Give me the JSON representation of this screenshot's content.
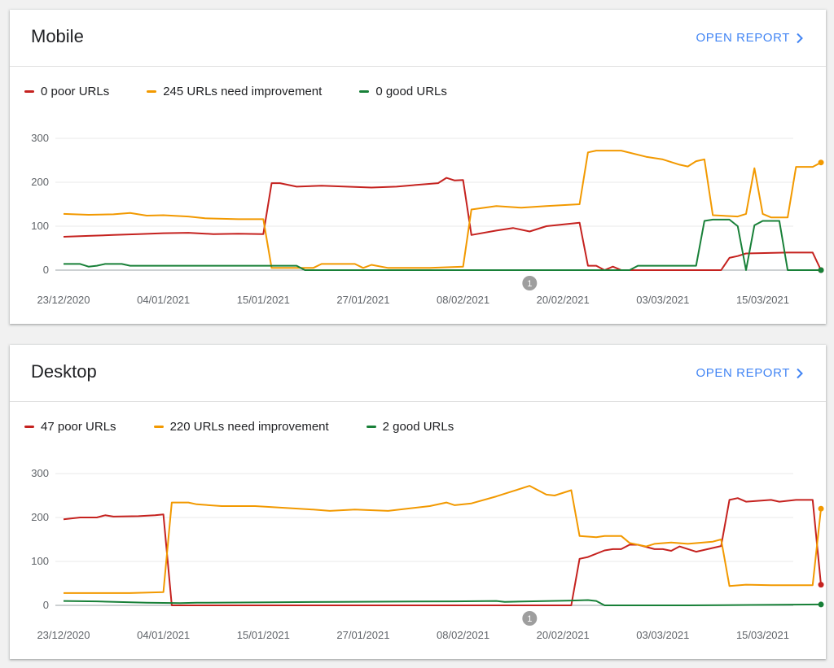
{
  "colors": {
    "poor": "#c5221f",
    "needs": "#f29900",
    "good": "#188038",
    "link": "#4285f4",
    "grid": "#e8e8e8",
    "axis": "#9aa0a6",
    "annotation": "#9e9e9e"
  },
  "open_report_label": "OPEN REPORT",
  "chart_data": [
    {
      "type": "line",
      "title": "Mobile",
      "legend": [
        "0 poor URLs",
        "245 URLs need improvement",
        "0 good URLs"
      ],
      "x_tick_labels": [
        "23/12/2020",
        "04/01/2021",
        "15/01/2021",
        "27/01/2021",
        "08/02/2021",
        "20/02/2021",
        "03/03/2021",
        "15/03/2021"
      ],
      "x_start": "2020-12-23",
      "y_ticks": [
        0,
        100,
        200,
        300
      ],
      "ylim": [
        0,
        300
      ],
      "annotations": [
        {
          "date": "2021-02-17",
          "label": "1"
        }
      ],
      "series": [
        {
          "key": "poor",
          "points": [
            [
              "2020-12-23",
              76
            ],
            [
              "2020-12-26",
              78
            ],
            [
              "2020-12-29",
              80
            ],
            [
              "2021-01-01",
              82
            ],
            [
              "2021-01-04",
              84
            ],
            [
              "2021-01-07",
              85
            ],
            [
              "2021-01-10",
              82
            ],
            [
              "2021-01-13",
              83
            ],
            [
              "2021-01-16",
              82
            ],
            [
              "2021-01-17",
              198
            ],
            [
              "2021-01-18",
              198
            ],
            [
              "2021-01-20",
              190
            ],
            [
              "2021-01-23",
              192
            ],
            [
              "2021-01-26",
              190
            ],
            [
              "2021-01-29",
              188
            ],
            [
              "2021-02-01",
              190
            ],
            [
              "2021-02-04",
              195
            ],
            [
              "2021-02-06",
              198
            ],
            [
              "2021-02-07",
              210
            ],
            [
              "2021-02-08",
              204
            ],
            [
              "2021-02-09",
              205
            ],
            [
              "2021-02-10",
              80
            ],
            [
              "2021-02-13",
              90
            ],
            [
              "2021-02-15",
              96
            ],
            [
              "2021-02-17",
              88
            ],
            [
              "2021-02-19",
              100
            ],
            [
              "2021-02-23",
              108
            ],
            [
              "2021-02-24",
              10
            ],
            [
              "2021-02-25",
              10
            ],
            [
              "2021-02-26",
              0
            ],
            [
              "2021-02-27",
              8
            ],
            [
              "2021-02-28",
              0
            ],
            [
              "2021-03-12",
              0
            ],
            [
              "2021-03-13",
              28
            ],
            [
              "2021-03-14",
              32
            ],
            [
              "2021-03-15",
              38
            ],
            [
              "2021-03-20",
              40
            ],
            [
              "2021-03-23",
              40
            ],
            [
              "2021-03-24",
              0
            ]
          ]
        },
        {
          "key": "needs",
          "points": [
            [
              "2020-12-23",
              128
            ],
            [
              "2020-12-26",
              126
            ],
            [
              "2020-12-29",
              127
            ],
            [
              "2020-12-31",
              130
            ],
            [
              "2021-01-02",
              124
            ],
            [
              "2021-01-04",
              125
            ],
            [
              "2021-01-07",
              122
            ],
            [
              "2021-01-09",
              118
            ],
            [
              "2021-01-13",
              116
            ],
            [
              "2021-01-16",
              116
            ],
            [
              "2021-01-17",
              5
            ],
            [
              "2021-01-20",
              5
            ],
            [
              "2021-01-22",
              5
            ],
            [
              "2021-01-23",
              14
            ],
            [
              "2021-01-27",
              14
            ],
            [
              "2021-01-28",
              5
            ],
            [
              "2021-01-29",
              12
            ],
            [
              "2021-01-31",
              5
            ],
            [
              "2021-02-05",
              5
            ],
            [
              "2021-02-09",
              8
            ],
            [
              "2021-02-10",
              138
            ],
            [
              "2021-02-13",
              146
            ],
            [
              "2021-02-16",
              142
            ],
            [
              "2021-02-19",
              146
            ],
            [
              "2021-02-23",
              150
            ],
            [
              "2021-02-24",
              268
            ],
            [
              "2021-02-25",
              272
            ],
            [
              "2021-02-28",
              272
            ],
            [
              "2021-03-03",
              258
            ],
            [
              "2021-03-05",
              252
            ],
            [
              "2021-03-07",
              240
            ],
            [
              "2021-03-08",
              236
            ],
            [
              "2021-03-09",
              248
            ],
            [
              "2021-03-10",
              252
            ],
            [
              "2021-03-11",
              125
            ],
            [
              "2021-03-14",
              122
            ],
            [
              "2021-03-15",
              128
            ],
            [
              "2021-03-16",
              232
            ],
            [
              "2021-03-17",
              128
            ],
            [
              "2021-03-18",
              120
            ],
            [
              "2021-03-20",
              120
            ],
            [
              "2021-03-21",
              235
            ],
            [
              "2021-03-23",
              235
            ],
            [
              "2021-03-24",
              245
            ]
          ]
        },
        {
          "key": "good",
          "points": [
            [
              "2020-12-23",
              14
            ],
            [
              "2020-12-25",
              14
            ],
            [
              "2020-12-26",
              8
            ],
            [
              "2020-12-27",
              10
            ],
            [
              "2020-12-28",
              14
            ],
            [
              "2020-12-30",
              14
            ],
            [
              "2020-12-31",
              10
            ],
            [
              "2021-01-20",
              10
            ],
            [
              "2021-01-21",
              0
            ],
            [
              "2021-03-01",
              0
            ],
            [
              "2021-03-02",
              10
            ],
            [
              "2021-03-08",
              10
            ],
            [
              "2021-03-09",
              10
            ],
            [
              "2021-03-10",
              112
            ],
            [
              "2021-03-11",
              115
            ],
            [
              "2021-03-13",
              115
            ],
            [
              "2021-03-14",
              100
            ],
            [
              "2021-03-15",
              0
            ],
            [
              "2021-03-16",
              102
            ],
            [
              "2021-03-17",
              112
            ],
            [
              "2021-03-19",
              112
            ],
            [
              "2021-03-20",
              0
            ],
            [
              "2021-03-24",
              0
            ]
          ]
        }
      ]
    },
    {
      "type": "line",
      "title": "Desktop",
      "legend": [
        "47 poor URLs",
        "220 URLs need improvement",
        "2 good URLs"
      ],
      "x_tick_labels": [
        "23/12/2020",
        "04/01/2021",
        "15/01/2021",
        "27/01/2021",
        "08/02/2021",
        "20/02/2021",
        "03/03/2021",
        "15/03/2021"
      ],
      "x_start": "2020-12-23",
      "y_ticks": [
        0,
        100,
        200,
        300
      ],
      "ylim": [
        0,
        300
      ],
      "annotations": [
        {
          "date": "2021-02-17",
          "label": "1"
        }
      ],
      "series": [
        {
          "key": "poor",
          "points": [
            [
              "2020-12-23",
              196
            ],
            [
              "2020-12-25",
              200
            ],
            [
              "2020-12-27",
              200
            ],
            [
              "2020-12-28",
              205
            ],
            [
              "2020-12-29",
              202
            ],
            [
              "2021-01-01",
              203
            ],
            [
              "2021-01-03",
              205
            ],
            [
              "2021-01-04",
              207
            ],
            [
              "2021-01-05",
              0
            ],
            [
              "2021-02-22",
              0
            ],
            [
              "2021-02-23",
              106
            ],
            [
              "2021-02-24",
              110
            ],
            [
              "2021-02-26",
              125
            ],
            [
              "2021-02-27",
              128
            ],
            [
              "2021-02-28",
              128
            ],
            [
              "2021-03-01",
              138
            ],
            [
              "2021-03-02",
              138
            ],
            [
              "2021-03-04",
              128
            ],
            [
              "2021-03-05",
              128
            ],
            [
              "2021-03-06",
              124
            ],
            [
              "2021-03-07",
              134
            ],
            [
              "2021-03-09",
              122
            ],
            [
              "2021-03-12",
              135
            ],
            [
              "2021-03-13",
              240
            ],
            [
              "2021-03-14",
              244
            ],
            [
              "2021-03-15",
              236
            ],
            [
              "2021-03-18",
              240
            ],
            [
              "2021-03-19",
              236
            ],
            [
              "2021-03-21",
              240
            ],
            [
              "2021-03-23",
              240
            ],
            [
              "2021-03-24",
              47
            ]
          ]
        },
        {
          "key": "needs",
          "points": [
            [
              "2020-12-23",
              28
            ],
            [
              "2020-12-31",
              28
            ],
            [
              "2021-01-04",
              30
            ],
            [
              "2021-01-05",
              234
            ],
            [
              "2021-01-07",
              234
            ],
            [
              "2021-01-08",
              230
            ],
            [
              "2021-01-11",
              226
            ],
            [
              "2021-01-15",
              226
            ],
            [
              "2021-01-22",
              218
            ],
            [
              "2021-01-24",
              215
            ],
            [
              "2021-01-27",
              218
            ],
            [
              "2021-01-31",
              215
            ],
            [
              "2021-02-05",
              226
            ],
            [
              "2021-02-07",
              234
            ],
            [
              "2021-02-08",
              228
            ],
            [
              "2021-02-10",
              232
            ],
            [
              "2021-02-13",
              248
            ],
            [
              "2021-02-15",
              260
            ],
            [
              "2021-02-17",
              272
            ],
            [
              "2021-02-19",
              252
            ],
            [
              "2021-02-20",
              250
            ],
            [
              "2021-02-22",
              262
            ],
            [
              "2021-02-23",
              158
            ],
            [
              "2021-02-25",
              155
            ],
            [
              "2021-02-26",
              158
            ],
            [
              "2021-02-28",
              158
            ],
            [
              "2021-03-01",
              142
            ],
            [
              "2021-03-03",
              134
            ],
            [
              "2021-03-04",
              140
            ],
            [
              "2021-03-06",
              143
            ],
            [
              "2021-03-08",
              140
            ],
            [
              "2021-03-11",
              145
            ],
            [
              "2021-03-12",
              150
            ],
            [
              "2021-03-13",
              44
            ],
            [
              "2021-03-15",
              47
            ],
            [
              "2021-03-18",
              46
            ],
            [
              "2021-03-23",
              46
            ],
            [
              "2021-03-24",
              220
            ]
          ]
        },
        {
          "key": "good",
          "points": [
            [
              "2020-12-23",
              10
            ],
            [
              "2020-12-27",
              9
            ],
            [
              "2021-01-02",
              6
            ],
            [
              "2021-01-06",
              5
            ],
            [
              "2021-01-08",
              6
            ],
            [
              "2021-01-17",
              7
            ],
            [
              "2021-01-25",
              8
            ],
            [
              "2021-02-08",
              9
            ],
            [
              "2021-02-13",
              10
            ],
            [
              "2021-02-14",
              8
            ],
            [
              "2021-02-22",
              11
            ],
            [
              "2021-02-24",
              12
            ],
            [
              "2021-02-25",
              10
            ],
            [
              "2021-02-26",
              0
            ],
            [
              "2021-03-08",
              0
            ],
            [
              "2021-03-24",
              2
            ]
          ]
        }
      ]
    }
  ]
}
